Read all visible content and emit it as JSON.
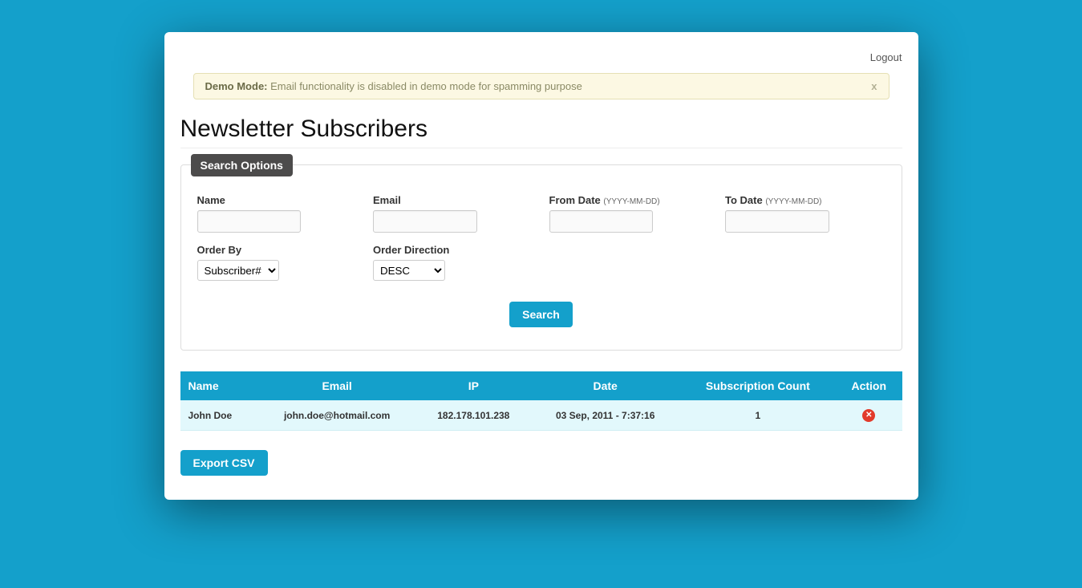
{
  "top": {
    "logout": "Logout"
  },
  "alert": {
    "strong": "Demo Mode:",
    "text": " Email functionality is disabled in demo mode for spamming purpose",
    "close": "x"
  },
  "page": {
    "title": "Newsletter Subscribers"
  },
  "search": {
    "legend": "Search Options",
    "labels": {
      "name": "Name",
      "email": "Email",
      "from_date": "From Date ",
      "from_date_hint": "(YYYY-MM-DD)",
      "to_date": "To Date ",
      "to_date_hint": "(YYYY-MM-DD)",
      "order_by": "Order By",
      "order_direction": "Order Direction"
    },
    "values": {
      "name": "",
      "email": "",
      "from_date": "",
      "to_date": "",
      "order_by": "Subscriber#",
      "order_direction": "DESC"
    },
    "button": "Search"
  },
  "table": {
    "headers": {
      "name": "Name",
      "email": "Email",
      "ip": "IP",
      "date": "Date",
      "sub_count": "Subscription Count",
      "action": "Action"
    },
    "rows": [
      {
        "name": "John Doe",
        "email": "john.doe@hotmail.com",
        "ip": "182.178.101.238",
        "date": "03 Sep, 2011 - 7:37:16",
        "sub_count": "1"
      }
    ]
  },
  "export": {
    "button": "Export CSV"
  }
}
